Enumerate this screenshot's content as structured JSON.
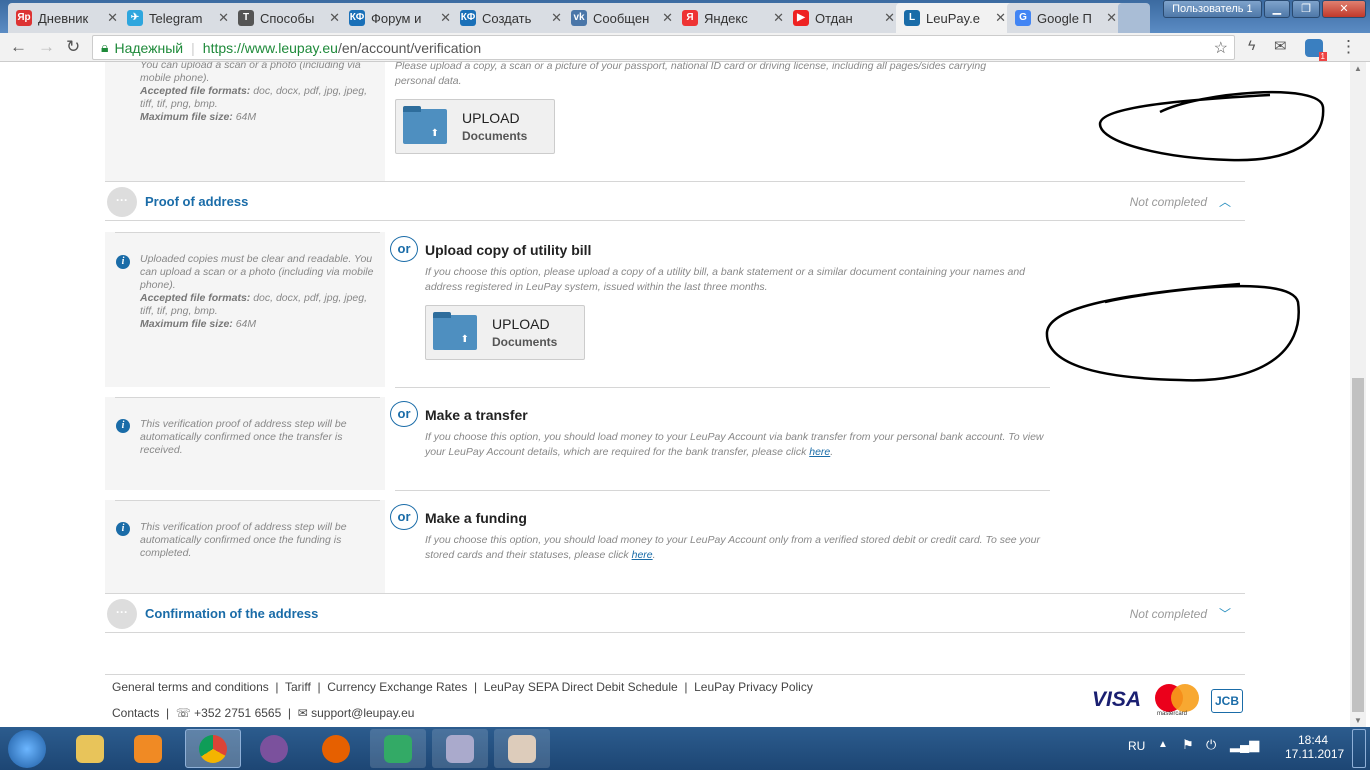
{
  "browser": {
    "tabs": [
      {
        "label": "Дневник",
        "icon": "Яр",
        "color": "#d33"
      },
      {
        "label": "Telegram",
        "icon": "✈",
        "color": "#2ea6de"
      },
      {
        "label": "Способы",
        "icon": "T",
        "color": "#555"
      },
      {
        "label": "Форум и",
        "icon": "КФ",
        "color": "#1a70b8"
      },
      {
        "label": "Создать",
        "icon": "КФ",
        "color": "#1a70b8"
      },
      {
        "label": "Сообщен",
        "icon": "vk",
        "color": "#4a76a8"
      },
      {
        "label": "Яндекс",
        "icon": "Я",
        "color": "#e33"
      },
      {
        "label": "Отдан",
        "icon": "▶",
        "color": "#e22"
      },
      {
        "label": "LeuPay.e",
        "icon": "L",
        "color": "#1a6ca8"
      },
      {
        "label": "Google П",
        "icon": "G",
        "color": "#4285f4"
      }
    ],
    "user_label": "Пользователь 1",
    "secure_label": "Надежный",
    "url_host": "https://www.leupay.eu",
    "url_path": "/en/account/verification",
    "ext_badge": "1"
  },
  "identity": {
    "note_top": "You can upload a scan or a photo (including via mobile phone).",
    "formats_label": "Accepted file formats:",
    "formats": "doc, docx, pdf, jpg, jpeg, tiff, tif, png, bmp.",
    "size_label": "Maximum file size:",
    "size": "64M",
    "desc": "Please upload a copy, a scan or a picture of your passport, national ID card or driving license, including all pages/sides carrying personal data.",
    "upload": "UPLOAD",
    "upload_sub": "Documents"
  },
  "proof": {
    "title": "Proof of address",
    "status": "Not completed",
    "or": "or",
    "note": "Uploaded copies must be clear and readable. You can upload a scan or a photo (including via mobile phone).",
    "formats_label": "Accepted file formats:",
    "formats": "doc, docx, pdf, jpg, jpeg, tiff, tif, png, bmp.",
    "size_label": "Maximum file size:",
    "size": "64M",
    "utility_title": "Upload copy of utility bill",
    "utility_desc": "If you choose this option, please upload a copy of a utility bill, a bank statement or a similar document containing your names and address registered in LeuPay system, issued within the last three months.",
    "upload": "UPLOAD",
    "upload_sub": "Documents",
    "transfer_note": "This verification proof of address step will be automatically confirmed once the transfer is received.",
    "transfer_title": "Make a transfer",
    "transfer_desc": "If you choose this option, you should load money to your LeuPay Account via bank transfer from your personal bank account. To view your LeuPay Account details, which are required for the bank transfer, please click ",
    "funding_note": "This verification proof of address step will be automatically confirmed once the funding is completed.",
    "funding_title": "Make a funding",
    "funding_desc": "If you choose this option, you should load money to your LeuPay Account only from a verified stored debit or credit card. To see your stored cards and their statuses, please click ",
    "here": "here"
  },
  "confirmation": {
    "title": "Confirmation of the address",
    "status": "Not completed"
  },
  "footer": {
    "links": [
      "General terms and conditions",
      "Tariff",
      "Currency Exchange Rates",
      "LeuPay SEPA Direct Debit Schedule",
      "LeuPay Privacy Policy"
    ],
    "contacts": "Contacts",
    "phone": "+352 2751 6565",
    "email": "support@leupay.eu",
    "cards": [
      "VISA",
      "mastercard",
      "JCB"
    ]
  },
  "taskbar": {
    "lang": "RU",
    "time": "18:44",
    "date": "17.11.2017"
  }
}
